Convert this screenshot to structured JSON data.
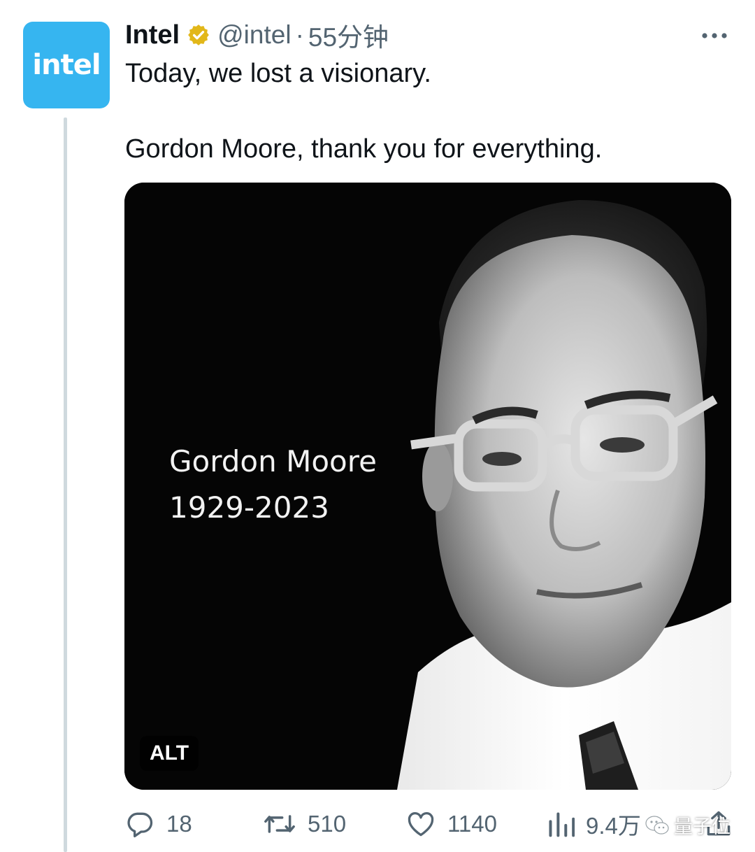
{
  "author": {
    "avatar_text": "intel",
    "display_name": "Intel",
    "handle": "@intel",
    "separator": "·",
    "time": "55分钟"
  },
  "tweet": {
    "line1": "Today, we lost a visionary.",
    "line2": "Gordon Moore, thank you for everything."
  },
  "media": {
    "overlay_name": "Gordon Moore",
    "overlay_years": "1929-2023",
    "alt_label": "ALT"
  },
  "actions": {
    "replies": "18",
    "retweets": "510",
    "likes": "1140",
    "views": "9.4万"
  },
  "watermark": {
    "text": "量子位"
  },
  "colors": {
    "avatar_bg": "#36b5f0",
    "verified": "#e2b719",
    "muted": "#536471",
    "thread_line": "#cfd9de"
  },
  "icons": [
    "verified-badge-icon",
    "more-icon",
    "reply-icon",
    "retweet-icon",
    "like-icon",
    "views-icon",
    "share-icon"
  ]
}
